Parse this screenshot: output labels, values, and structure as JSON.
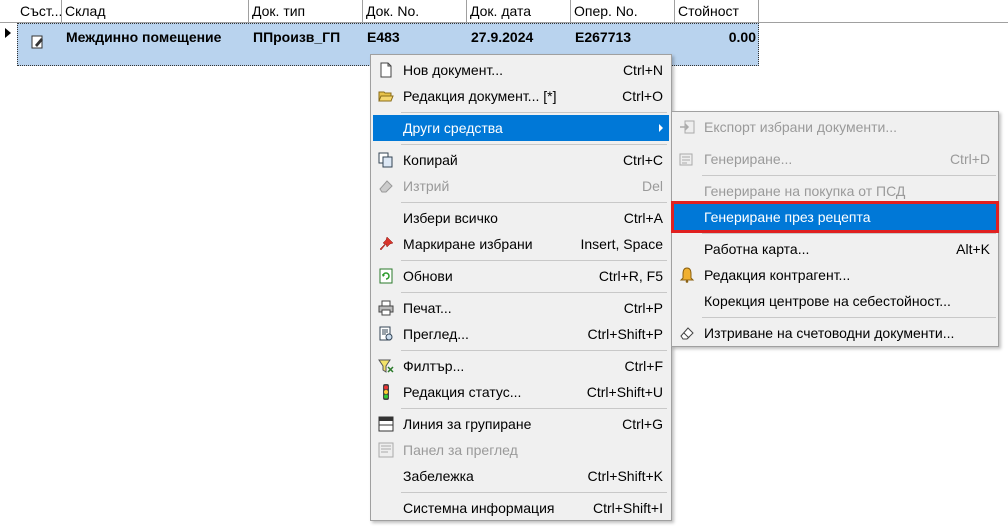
{
  "grid": {
    "columns": [
      "Съст...",
      "Склад",
      "Док. тип",
      "Док. No.",
      "Док. дата",
      "Опер. No.",
      "Стойност"
    ],
    "row": {
      "warehouse": "Междинно помещение",
      "doc_type": "ППроизв_ГП",
      "doc_no": "Е483",
      "doc_date": "27.9.2024",
      "oper_no": "Е267713",
      "value": "0.00"
    }
  },
  "context_menu": {
    "new_document": {
      "label": "Нов документ...",
      "shortcut": "Ctrl+N"
    },
    "edit_document": {
      "label": "Редакция документ... [*]",
      "shortcut": "Ctrl+O"
    },
    "other_tools": {
      "label": "Други средства"
    },
    "copy": {
      "label": "Копирай",
      "shortcut": "Ctrl+C"
    },
    "delete": {
      "label": "Изтрий",
      "shortcut": "Del"
    },
    "select_all": {
      "label": "Избери всичко",
      "shortcut": "Ctrl+A"
    },
    "mark_selected": {
      "label": "Маркиране избрани",
      "shortcut": "Insert, Space"
    },
    "refresh": {
      "label": "Обнови",
      "shortcut": "Ctrl+R, F5"
    },
    "print": {
      "label": "Печат...",
      "shortcut": "Ctrl+P"
    },
    "preview": {
      "label": "Преглед...",
      "shortcut": "Ctrl+Shift+P"
    },
    "filter": {
      "label": "Филтър...",
      "shortcut": "Ctrl+F"
    },
    "edit_status": {
      "label": "Редакция статус...",
      "shortcut": "Ctrl+Shift+U"
    },
    "group_line": {
      "label": "Линия за групиране",
      "shortcut": "Ctrl+G"
    },
    "preview_panel": {
      "label": "Панел за преглед",
      "shortcut": ""
    },
    "note": {
      "label": "Забележка",
      "shortcut": "Ctrl+Shift+K"
    },
    "system_info": {
      "label": "Системна информация",
      "shortcut": "Ctrl+Shift+I"
    }
  },
  "submenu": {
    "export_selected": {
      "label": "Експорт избрани документи..."
    },
    "generate": {
      "label": "Генериране...",
      "shortcut": "Ctrl+D"
    },
    "generate_purchase": {
      "label": "Генериране на покупка от ПСД"
    },
    "generate_recipe": {
      "label": "Генериране през рецепта"
    },
    "work_card": {
      "label": "Работна карта...",
      "shortcut": "Alt+K"
    },
    "edit_partner": {
      "label": "Редакция контрагент..."
    },
    "cost_centers": {
      "label": "Корекция центрове на себестойност..."
    },
    "delete_accounting": {
      "label": "Изтриване на счетоводни документи..."
    }
  },
  "colors": {
    "selection": "#0078d7",
    "row_highlight": "#b9d3ee",
    "callout": "#e02020"
  }
}
